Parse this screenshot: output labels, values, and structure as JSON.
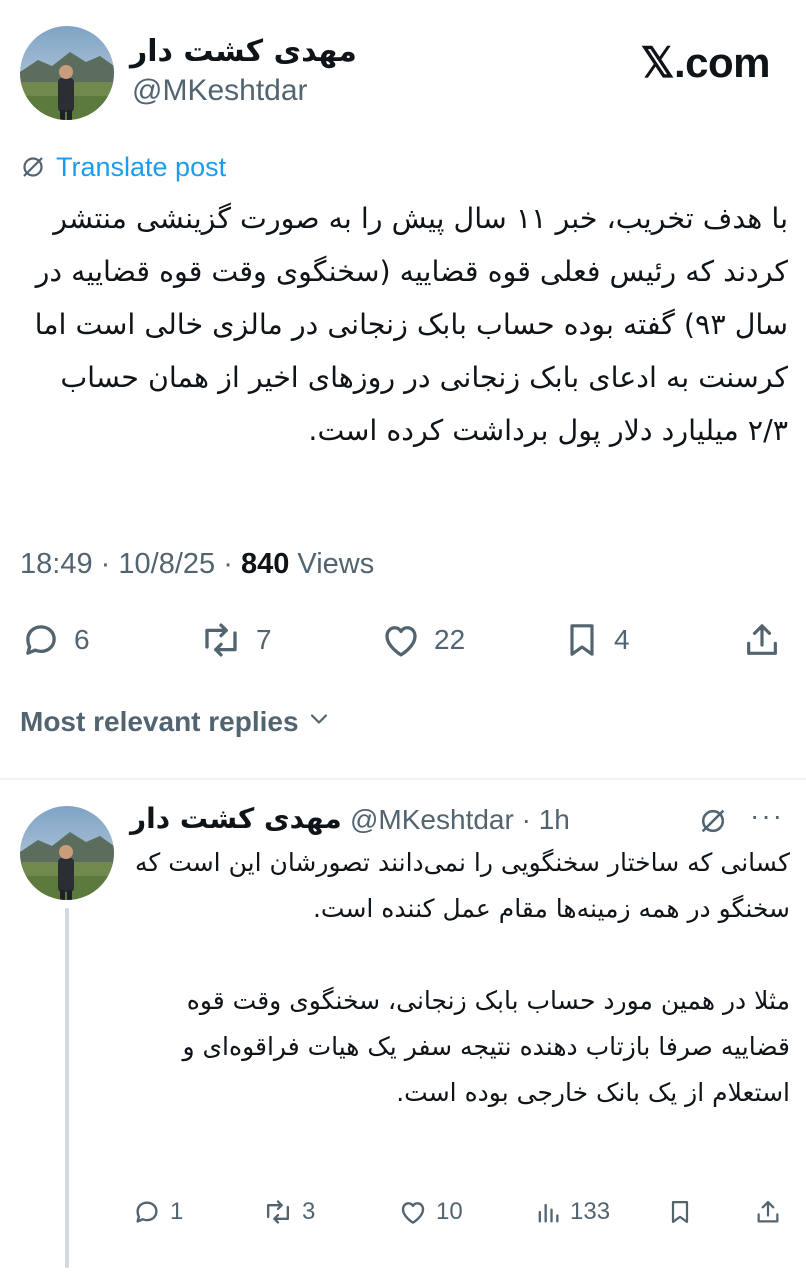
{
  "brand": {
    "label": "𝕏.com"
  },
  "author": {
    "display_name": "مهدی کشت دار",
    "handle": "@MKeshtdar"
  },
  "translate": {
    "label": "Translate post",
    "icon": "translate-icon"
  },
  "tweet": {
    "text": "با هدف تخریب، خبر ۱۱ سال پیش را به صورت گزینشی منتشر کردند که رئیس فعلی قوه قضاییه (سخنگوی وقت قوه قضاییه در سال ۹۳) گفته بوده حساب بابک زنجانی در مالزی خالی است اما کرسنت به ادعای بابک زنجانی در روزهای اخیر از همان حساب ۲/۳ میلیارد دلار پول برداشت کرده است.",
    "time": "18:49",
    "date": "10/8/25",
    "views_count": "840",
    "views_label": "Views",
    "sep": "·"
  },
  "actions": {
    "replies": "6",
    "reposts": "7",
    "likes": "22",
    "bookmarks": "4"
  },
  "sort": {
    "label": "Most relevant replies"
  },
  "reply": {
    "display_name": "مهدی کشت دار",
    "handle_time": "@MKeshtdar · 1h",
    "more": "···",
    "text": "کسانی که ساختار سخنگویی را نمی‌دانند تصورشان این است که سخنگو در همه زمینه‌ها مقام عمل کننده است.\n\nمثلا در همین مورد حساب بابک زنجانی، سخنگوی وقت قوه قضاییه صرفا بازتاب دهنده نتیجه سفر یک هیات فراقوه‌ای و استعلام از یک بانک خارجی بوده است.",
    "actions": {
      "replies": "1",
      "reposts": "3",
      "likes": "10",
      "views": "133"
    }
  },
  "colors": {
    "text": "#0f1419",
    "secondary": "#536471",
    "accent": "#1d9bf0",
    "divider": "#eff3f4"
  }
}
